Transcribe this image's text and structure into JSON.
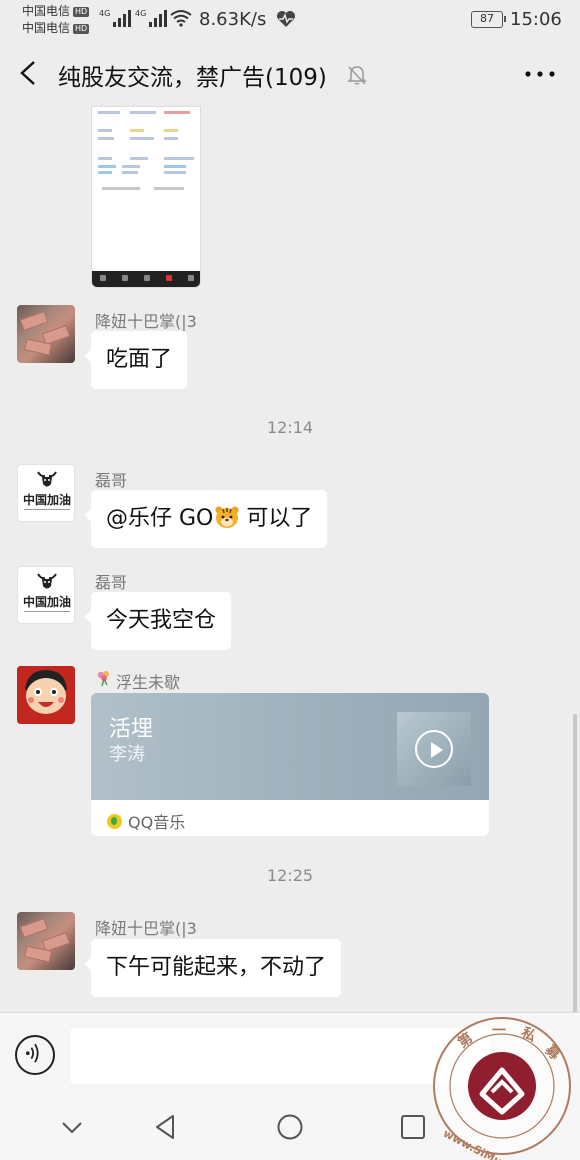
{
  "status_bar": {
    "carrier1": "中国电信",
    "carrier2": "中国电信",
    "hd": "HD",
    "net_label": "4G",
    "speed": "8.63K/s",
    "battery": "87",
    "time": "15:06"
  },
  "header": {
    "title": "纯股友交流，禁广告(109)"
  },
  "messages": [
    {
      "sender": "降妞十巴掌(|3",
      "text": "吃面了"
    },
    {
      "sender": "磊哥",
      "text_before": "@乐仔 GO",
      "text_after": "可以了"
    },
    {
      "sender": "磊哥",
      "text": "今天我空仓"
    },
    {
      "sender": "浮生未歇"
    },
    {
      "sender": "降妞十巴掌(|3",
      "text": "下午可能起来，不动了"
    }
  ],
  "timestamps": [
    "12:14",
    "12:25"
  ],
  "music_card": {
    "song": "活埋",
    "artist": "李涛",
    "source": "QQ音乐"
  },
  "avatars": {
    "china_text": "中国加油"
  },
  "watermark": {
    "chars": [
      "第",
      "一",
      "私",
      "募"
    ],
    "url": "www.SiMu001.cn"
  },
  "colors": {
    "background": "#ededed",
    "bubble": "#ffffff",
    "music_card": "#a3b5c0"
  }
}
